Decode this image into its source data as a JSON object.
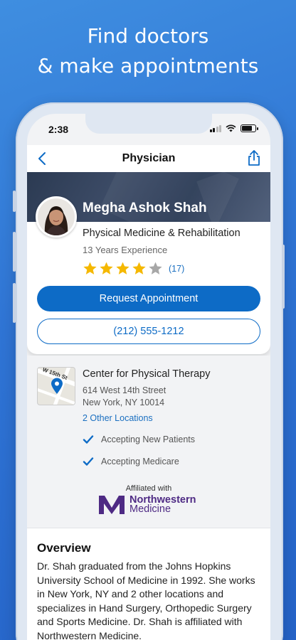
{
  "headline": {
    "line1": "Find doctors",
    "line2": "& make appointments"
  },
  "status_bar": {
    "time": "2:38"
  },
  "navbar": {
    "title": "Physician",
    "back_icon": "chevron-left-icon",
    "share_icon": "share-icon"
  },
  "doctor": {
    "name": "Megha Ashok Shah",
    "specialty": "Physical Medicine & Rehabilitation",
    "experience": "13 Years Experience",
    "rating": 4,
    "rating_max": 5,
    "review_count": "(17)"
  },
  "actions": {
    "request_label": "Request Appointment",
    "phone_label": "(212) 555-1212"
  },
  "location": {
    "map_street_label": "W 15th St",
    "name": "Center for Physical Therapy",
    "address_line1": "614 West 14th Street",
    "address_line2": "New York, NY 10014",
    "other_locations_link": "2 Other Locations",
    "features": [
      "Accepting New Patients",
      "Accepting Medicare"
    ]
  },
  "affiliation": {
    "label": "Affiliated with",
    "logo_line1": "Northwestern",
    "logo_line2": "Medicine"
  },
  "overview": {
    "title": "Overview",
    "text": "Dr. Shah graduated from the Johns Hopkins University School of Medicine in 1992. She works in New York, NY and 2 other locations and specializes in Hand Surgery, Orthopedic Surgery and Sports Medicine. Dr. Shah is affiliated with Northwestern Medicine."
  },
  "colors": {
    "background": "#2f74d4",
    "primary": "#0d6bc6",
    "star_filled": "#f5b800",
    "star_empty": "#a7a7a7",
    "brand_purple": "#4e2a84"
  }
}
